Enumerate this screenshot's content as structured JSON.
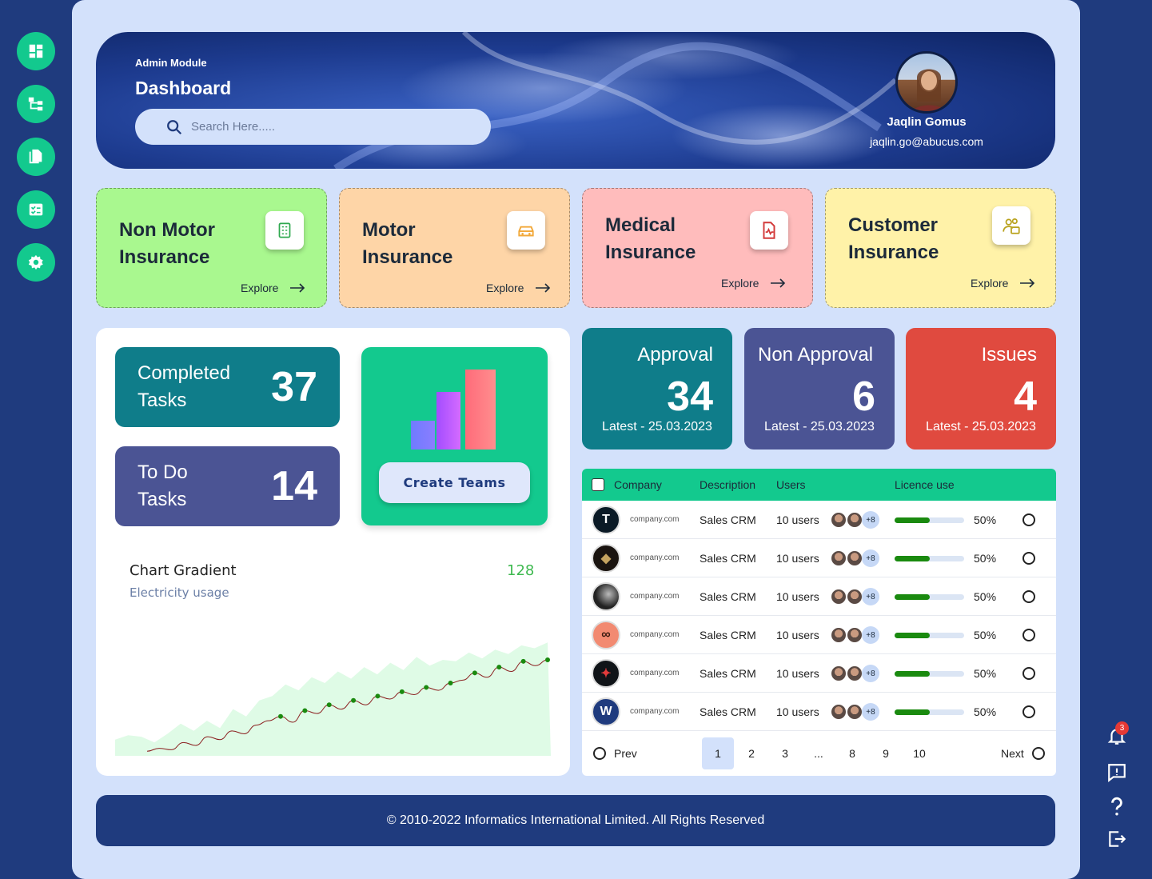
{
  "sidebar": {
    "items": [
      {
        "name": "dashboard-icon"
      },
      {
        "name": "hierarchy-icon"
      },
      {
        "name": "documents-icon"
      },
      {
        "name": "checklist-icon"
      },
      {
        "name": "settings-icon"
      }
    ]
  },
  "header": {
    "module": "Admin Module",
    "title": "Dashboard",
    "search_placeholder": "Search Here.....",
    "user_name": "Jaqlin Gomus",
    "user_email": "jaqlin.go@abucus.com"
  },
  "insurance_cards": [
    {
      "title": "Non Motor Insurance",
      "line1": "Non Motor",
      "line2": "Insurance",
      "explore": "Explore",
      "color": "#a9f88f",
      "icon": "clipboard-icon",
      "icon_color": "#2fa84f"
    },
    {
      "title": "Motor Insurance",
      "line1": "Motor",
      "line2": "Insurance",
      "explore": "Explore",
      "color": "#fed5a7",
      "icon": "car-icon",
      "icon_color": "#f2a93b"
    },
    {
      "title": "Medical Insurance",
      "line1": "Medical",
      "line2": "Insurance",
      "explore": "Explore",
      "color": "#ffbcbc",
      "icon": "medical-file-icon",
      "icon_color": "#d33a3a"
    },
    {
      "title": "Customer Insurance",
      "line1": "Customer",
      "line2": "Insurance",
      "explore": "Explore",
      "color": "#fff2a8",
      "icon": "customer-icon",
      "icon_color": "#b9a21c"
    }
  ],
  "tasks": {
    "completed": {
      "line1": "Completed",
      "line2": "Tasks",
      "value": "37",
      "color": "#0f7d8a"
    },
    "todo": {
      "line1": "To Do",
      "line2": "Tasks",
      "value": "14",
      "color": "#4b5494"
    }
  },
  "teams": {
    "button": "Create Teams",
    "color": "#13c98e"
  },
  "chart": {
    "title": "Chart Gradient",
    "subtitle": "Electricity usage",
    "value": "128"
  },
  "chart_data": {
    "type": "line",
    "title": "Chart Gradient",
    "series": [
      {
        "values": [
          2,
          6,
          4,
          14,
          10,
          22,
          18,
          30,
          26,
          38,
          44,
          50,
          42,
          58,
          54,
          66,
          60,
          72,
          66,
          78,
          74,
          84,
          80,
          90,
          86,
          96,
          100,
          110,
          104,
          118,
          112,
          126,
          120,
          128
        ]
      }
    ],
    "area_values": [
      18,
      24,
      22,
      14,
      26,
      40,
      30,
      44,
      34,
      60,
      50,
      72,
      78,
      94,
      86,
      104,
      96,
      112,
      102,
      118,
      108,
      124,
      114,
      132,
      120,
      128,
      126,
      138,
      130,
      142,
      136,
      148,
      144,
      152
    ],
    "grid": false
  },
  "stats": [
    {
      "title": "Approval",
      "value": "34",
      "latest": "Latest - 25.03.2023",
      "color": "#0f7d8a"
    },
    {
      "title": "Non Approval",
      "value": "6",
      "latest": "Latest - 25.03.2023",
      "color": "#4b5494"
    },
    {
      "title": "Issues",
      "value": "4",
      "latest": "Latest - 25.03.2023",
      "color": "#e04a3f"
    }
  ],
  "table": {
    "headers": {
      "company": "Company",
      "description": "Description",
      "users": "Users",
      "licence": "Licence use"
    },
    "rows": [
      {
        "logo": "tesla-logo",
        "domain": "company.com",
        "description": "Sales CRM",
        "users": "10 users",
        "more": "+8",
        "licence": 0.5,
        "pct": "50%"
      },
      {
        "logo": "porsche-logo",
        "domain": "company.com",
        "description": "Sales CRM",
        "users": "10 users",
        "more": "+8",
        "licence": 0.5,
        "pct": "50%"
      },
      {
        "logo": "sphere-logo",
        "domain": "company.com",
        "description": "Sales CRM",
        "users": "10 users",
        "more": "+8",
        "licence": 0.5,
        "pct": "50%"
      },
      {
        "logo": "mustache-logo",
        "domain": "company.com",
        "description": "Sales CRM",
        "users": "10 users",
        "more": "+8",
        "licence": 0.5,
        "pct": "50%"
      },
      {
        "logo": "redbull-logo",
        "domain": "company.com",
        "description": "Sales CRM",
        "users": "10 users",
        "more": "+8",
        "licence": 0.5,
        "pct": "50%"
      },
      {
        "logo": "volkswagen-logo",
        "domain": "company.com",
        "description": "Sales CRM",
        "users": "10 users",
        "more": "+8",
        "licence": 0.5,
        "pct": "50%"
      }
    ],
    "pager": {
      "prev": "Prev",
      "next": "Next",
      "pages": [
        "1",
        "2",
        "3",
        "...",
        "8",
        "9",
        "10"
      ],
      "active": "1"
    }
  },
  "footer": {
    "text": "© 2010-2022 Informatics International Limited. All Rights Reserved"
  },
  "rail": {
    "notification_count": "3"
  }
}
